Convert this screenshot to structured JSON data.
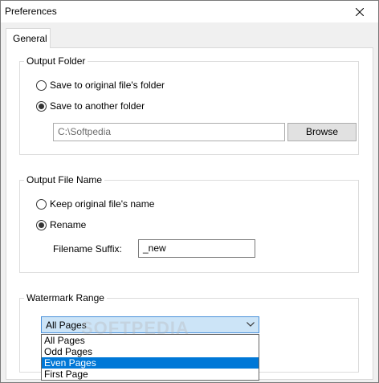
{
  "window": {
    "title": "Preferences"
  },
  "tabs": [
    {
      "label": "General",
      "active": true
    }
  ],
  "output_folder": {
    "legend": "Output Folder",
    "options": [
      {
        "label": "Save to original file's folder",
        "checked": false
      },
      {
        "label": "Save to another folder",
        "checked": true
      }
    ],
    "path_value": "C:\\Softpedia",
    "browse_label": "Browse"
  },
  "output_file_name": {
    "legend": "Output File Name",
    "options": [
      {
        "label": "Keep original file's name",
        "checked": false
      },
      {
        "label": "Rename",
        "checked": true
      }
    ],
    "suffix_label": "Filename Suffix:",
    "suffix_value": "_new"
  },
  "watermark_range": {
    "legend": "Watermark Range",
    "selected": "All Pages",
    "options": [
      "All Pages",
      "Odd Pages",
      "Even Pages",
      "First Page"
    ],
    "highlighted": "Even Pages"
  },
  "watermark_overlay_text": "SOFTPEDIA"
}
